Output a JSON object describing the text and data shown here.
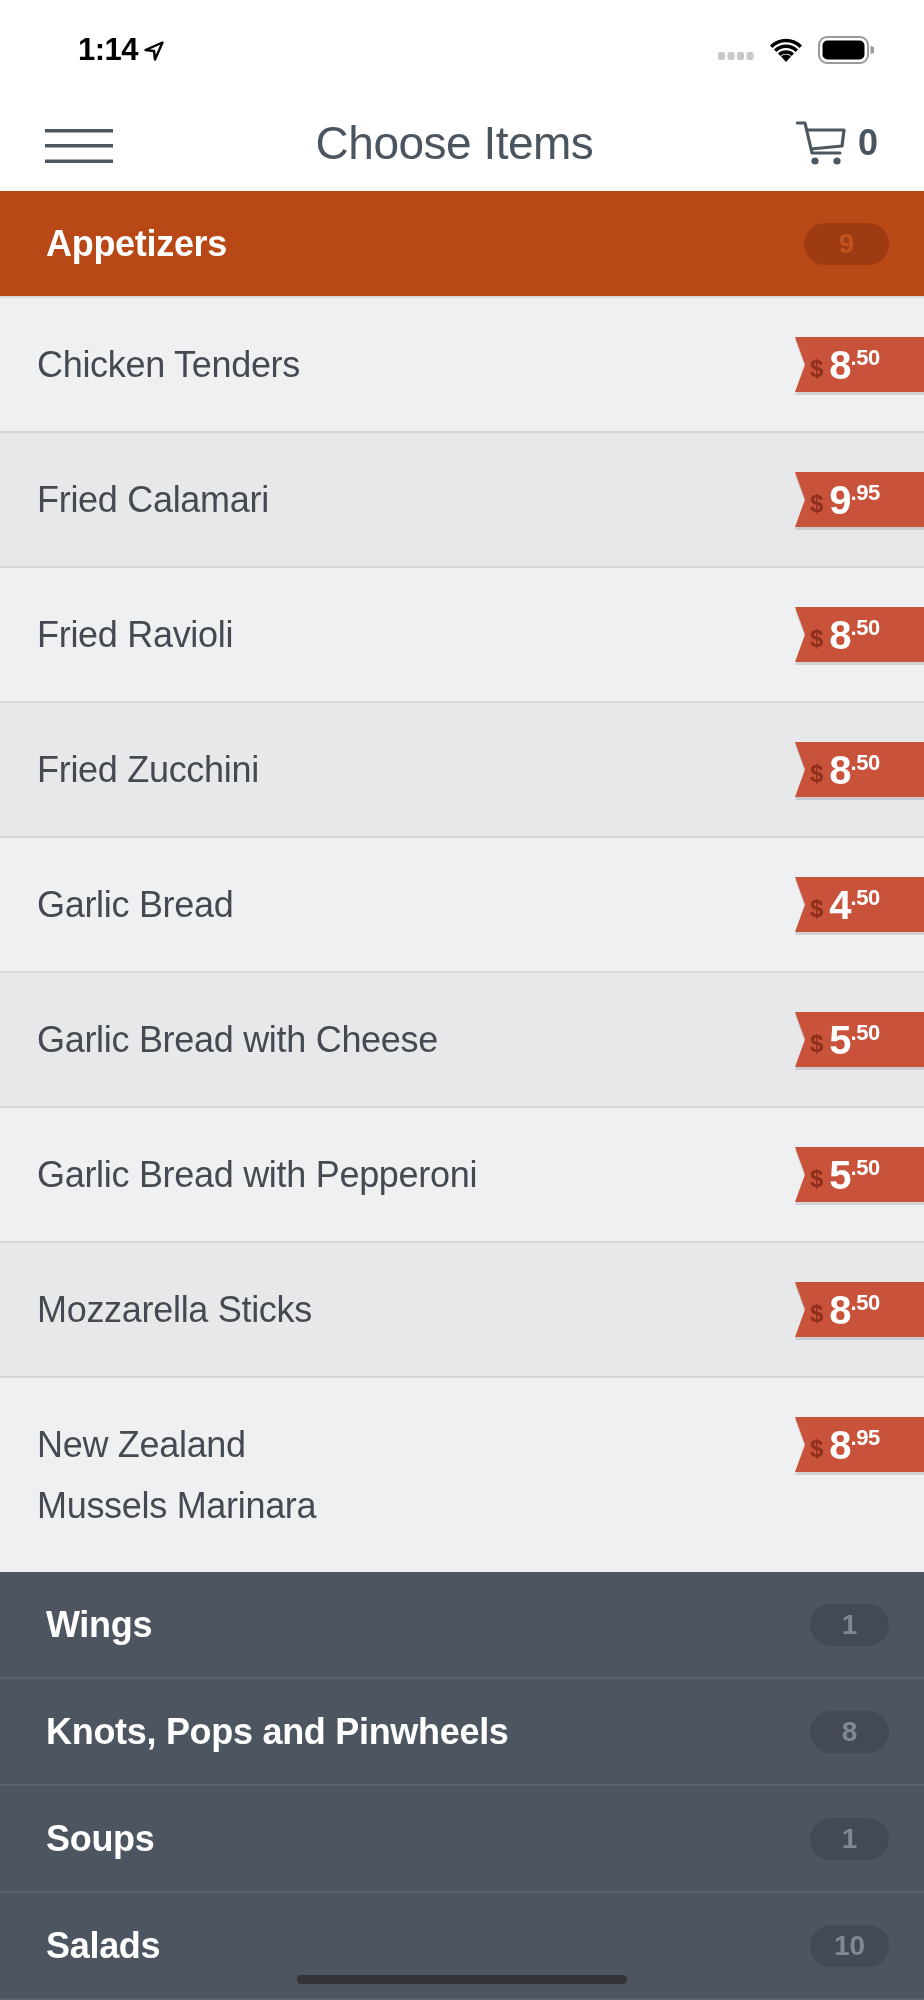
{
  "status_bar": {
    "time": "1:14"
  },
  "header": {
    "title": "Choose Items",
    "cart_count": "0"
  },
  "categories": [
    {
      "name": "Appetizers",
      "count": "9",
      "expanded": true,
      "items": [
        {
          "name": "Chicken Tenders",
          "price": {
            "currency": "$",
            "amount": "8$^{.50}$"
          }
        },
        {
          "name": "Fried Calamari",
          "price": {
            "currency": "$",
            "amount": "9$^{.95}$"
          }
        },
        {
          "name": "Fried Ravioli",
          "price": {
            "currency": "$",
            "amount": "8$^{.50}$"
          }
        },
        {
          "name": "Fried Zucchini",
          "price": {
            "currency": "$",
            "amount": "8$^{.50}$"
          }
        },
        {
          "name": "Garlic Bread",
          "price": {
            "currency": "$",
            "amount": "4$^{.50}$"
          }
        },
        {
          "name": "Garlic Bread with Cheese",
          "price": {
            "currency": "$",
            "amount": "5$^{.50}$"
          }
        },
        {
          "name": "Garlic Bread with Pepperoni",
          "price": {
            "currency": "$",
            "amount": "5$^{.50}$"
          }
        },
        {
          "name": "Mozzarella Sticks",
          "price": {
            "currency": "$",
            "amount": "8$^{.50}$"
          }
        },
        {
          "name": "New Zealand\nMussels Marinara",
          "price": {
            "currency": "$",
            "amount": "8$^{.95}$"
          }
        }
      ]
    },
    {
      "name": "Wings",
      "count": "1",
      "expanded": false
    },
    {
      "name": "Knots, Pops and Pinwheels",
      "count": "8",
      "expanded": false
    },
    {
      "name": "Soups",
      "count": "1",
      "expanded": false
    },
    {
      "name": "Salads",
      "count": "10",
      "expanded": false
    }
  ]
}
